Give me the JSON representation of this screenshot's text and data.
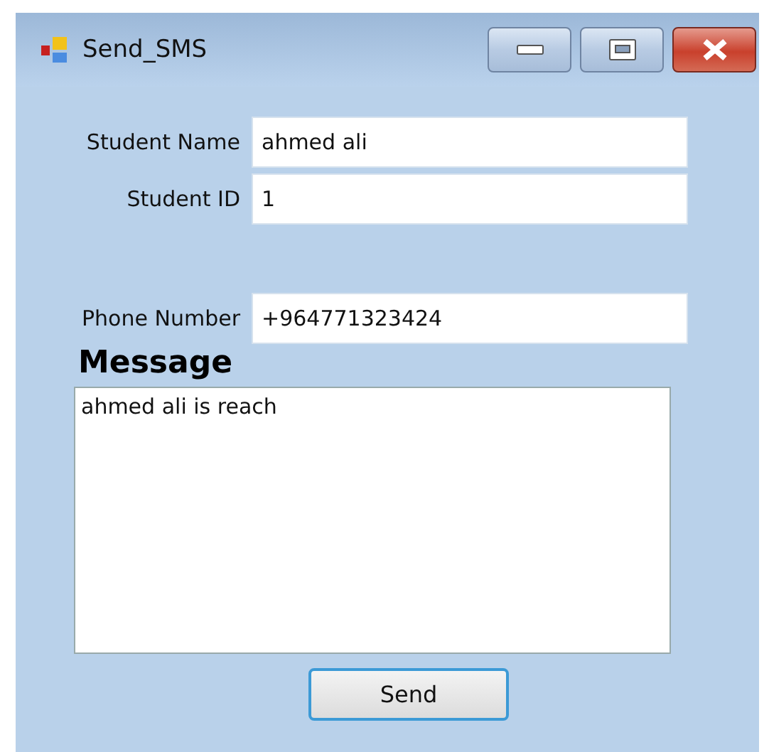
{
  "window": {
    "title": "Send_SMS"
  },
  "fields": [
    {
      "label": "Student Name",
      "value": "ahmed ali"
    },
    {
      "label": "Student ID",
      "value": "1"
    },
    {
      "label": "Phone Number",
      "value": "+964771323424"
    }
  ],
  "message": {
    "label": "Message",
    "value": "ahmed ali is reach"
  },
  "button": "Send"
}
